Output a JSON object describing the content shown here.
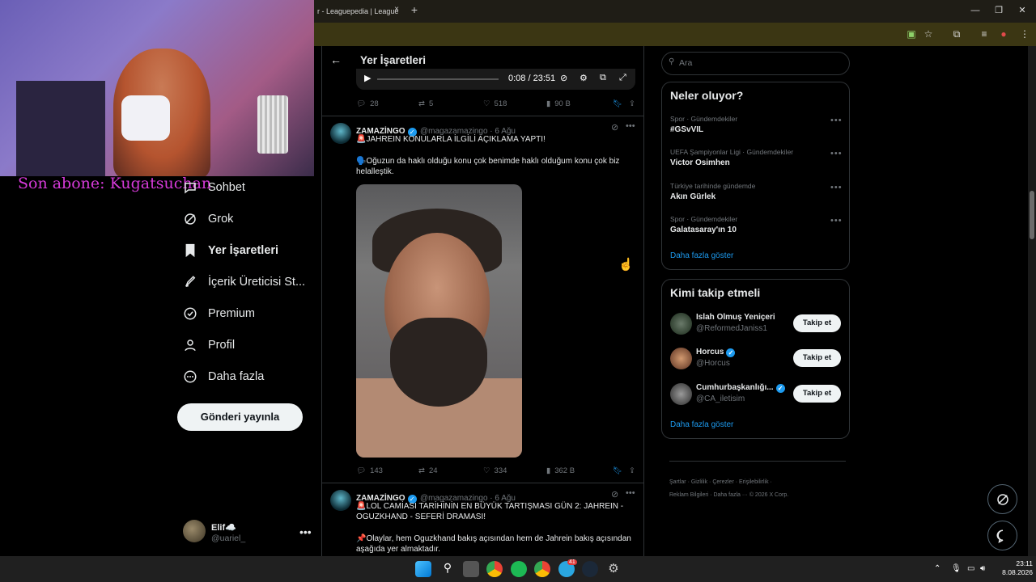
{
  "browser": {
    "tab_title": "r - Leaguepedia | League",
    "tab_close": "×",
    "new_tab": "+"
  },
  "overlay": {
    "subscriber_text": "Son abone: Kugatsuchan"
  },
  "nav": {
    "items": [
      {
        "label": "Sohbet"
      },
      {
        "label": "Grok"
      },
      {
        "label": "Yer İşaretleri"
      },
      {
        "label": "İçerik Üreticisi St..."
      },
      {
        "label": "Premium"
      },
      {
        "label": "Profil"
      },
      {
        "label": "Daha fazla"
      }
    ],
    "post_button": "Gönderi yayınla",
    "account": {
      "name": "Elif☁️",
      "handle": "@uariel_",
      "more": "•••"
    }
  },
  "header": {
    "title": "Yer İşaretleri",
    "back": "←"
  },
  "video": {
    "time": "0:08 / 23:51"
  },
  "tweets": [
    {
      "replies": "28",
      "reposts": "5",
      "likes": "518",
      "views": "90 B"
    },
    {
      "name": "ZAMAZİNGO",
      "handle": "@magazamazingo · 6 Ağu",
      "line1": "🚨JAHREIN KONULARLA İLGİLİ AÇIKLAMA YAPTI!",
      "line2": "🗣️Oğuzun da haklı olduğu konu çok benimde haklı olduğum konu çok biz helalleştik.",
      "replies": "143",
      "reposts": "24",
      "likes": "334",
      "views": "362 B"
    },
    {
      "name": "ZAMAZİNGO",
      "handle": "@magazamazingo · 6 Ağu",
      "line1": "🚨LOL CAMİASI TARİHİNİN EN BÜYÜK TARTIŞMASI GÜN 2: JAHREIN - OGUZKHAND - SEFERİ DRAMASI!",
      "line2": "📌Olaylar, hem Oguzkhand bakış açısından hem de Jahrein bakış açısından aşağıda yer almaktadır."
    }
  ],
  "search": {
    "placeholder": "Ara"
  },
  "trends": {
    "title": "Neler oluyor?",
    "items": [
      {
        "meta": "Spor · Gündemdekiler",
        "name": "#GSvVIL"
      },
      {
        "meta": "UEFA Şampiyonlar Ligi · Gündemdekiler",
        "name": "Victor Osimhen"
      },
      {
        "meta": "Türkiye tarihinde gündemde",
        "name": "Akın Gürlek"
      },
      {
        "meta": "Spor · Gündemdekiler",
        "name": "Galatasaray'ın 10"
      }
    ],
    "show_more": "Daha fazla göster"
  },
  "who_to_follow": {
    "title": "Kimi takip etmeli",
    "items": [
      {
        "name": "Islah Olmuş Yeniçeri",
        "handle": "@ReformedJaniss1",
        "button": "Takip et"
      },
      {
        "name": "Horcus",
        "handle": "@Horcus",
        "button": "Takip et"
      },
      {
        "name": "Cumhurbaşkanlığı...",
        "handle": "@CA_iletisim",
        "button": "Takip et"
      }
    ],
    "show_more": "Daha fazla göster"
  },
  "footer": {
    "row1": [
      "Şartlar",
      "Gizlilik",
      "Çerezler",
      "Erişilebilirlik"
    ],
    "row2": [
      "Reklam Bilgileri",
      "Daha fazla ···",
      "© 2026 X Corp."
    ]
  },
  "taskbar": {
    "time": "23:11",
    "date": "8.08.2026",
    "badge": "41"
  },
  "colors": {
    "accent": "#1d9bf0",
    "overlay_text": "#d63ad9"
  }
}
